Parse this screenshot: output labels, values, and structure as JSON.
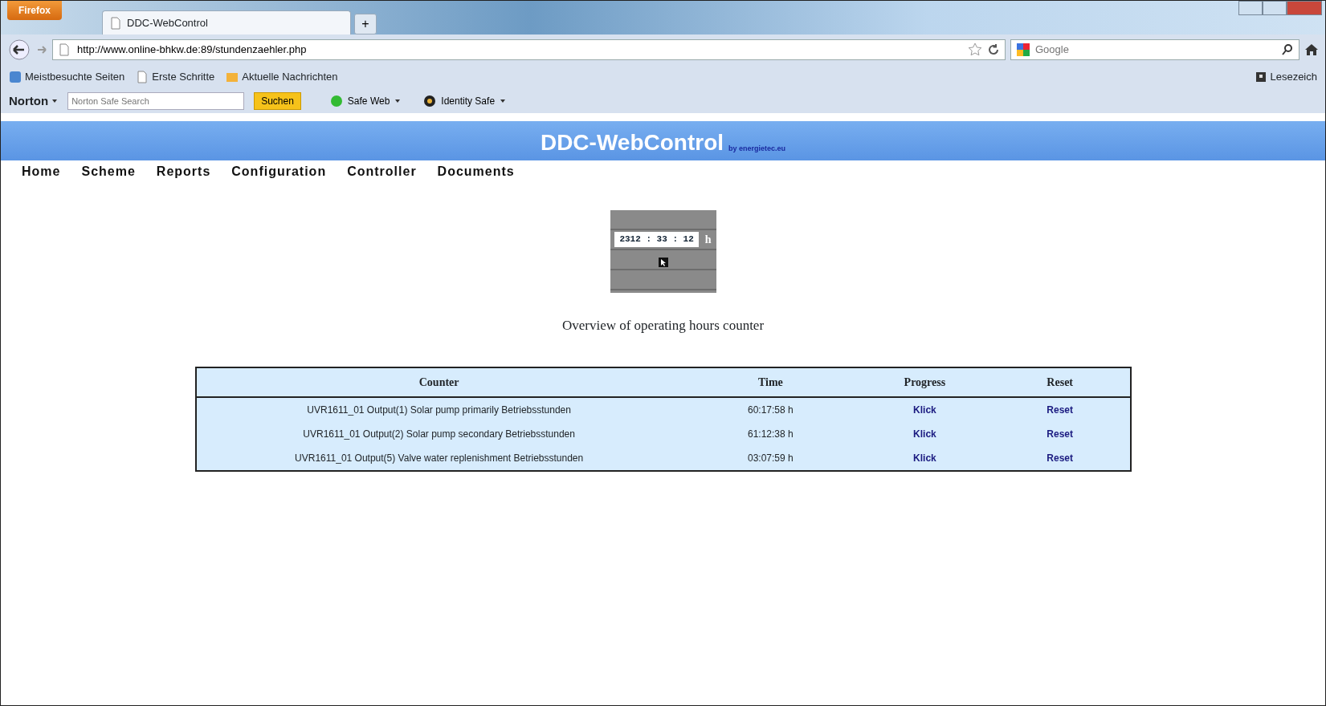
{
  "browser": {
    "menu_button": "Firefox",
    "tab_title": "DDC-WebControl",
    "new_tab": "+",
    "url": "http://www.online-bhkw.de:89/stundenzaehler.php",
    "search_placeholder": "Google",
    "bookmarks": [
      "Meistbesuchte Seiten",
      "Erste Schritte",
      "Aktuelle Nachrichten"
    ],
    "bookmarks_menu": "Lesezeich",
    "norton": {
      "brand": "Norton",
      "search_placeholder": "Norton Safe Search",
      "search_button": "Suchen",
      "safe_web": "Safe Web",
      "identity_safe": "Identity Safe"
    }
  },
  "header": {
    "title": "DDC-WebControl",
    "byline": "by energietec.eu"
  },
  "nav": [
    "Home",
    "Scheme",
    "Reports",
    "Configuration",
    "Controller",
    "Documents"
  ],
  "counter_widget": {
    "value": "2312 : 33 : 12",
    "unit": "h"
  },
  "caption": "Overview of operating hours counter",
  "table": {
    "columns": [
      "Counter",
      "Time",
      "Progress",
      "Reset"
    ],
    "rows": [
      {
        "counter": "UVR1611_01 Output(1) Solar pump primarily Betriebsstunden",
        "time": "60:17:58 h",
        "progress": "Klick",
        "reset": "Reset"
      },
      {
        "counter": "UVR1611_01 Output(2) Solar pump secondary Betriebsstunden",
        "time": "61:12:38 h",
        "progress": "Klick",
        "reset": "Reset"
      },
      {
        "counter": "UVR1611_01 Output(5) Valve water replenishment Betriebsstunden",
        "time": "03:07:59 h",
        "progress": "Klick",
        "reset": "Reset"
      }
    ]
  }
}
